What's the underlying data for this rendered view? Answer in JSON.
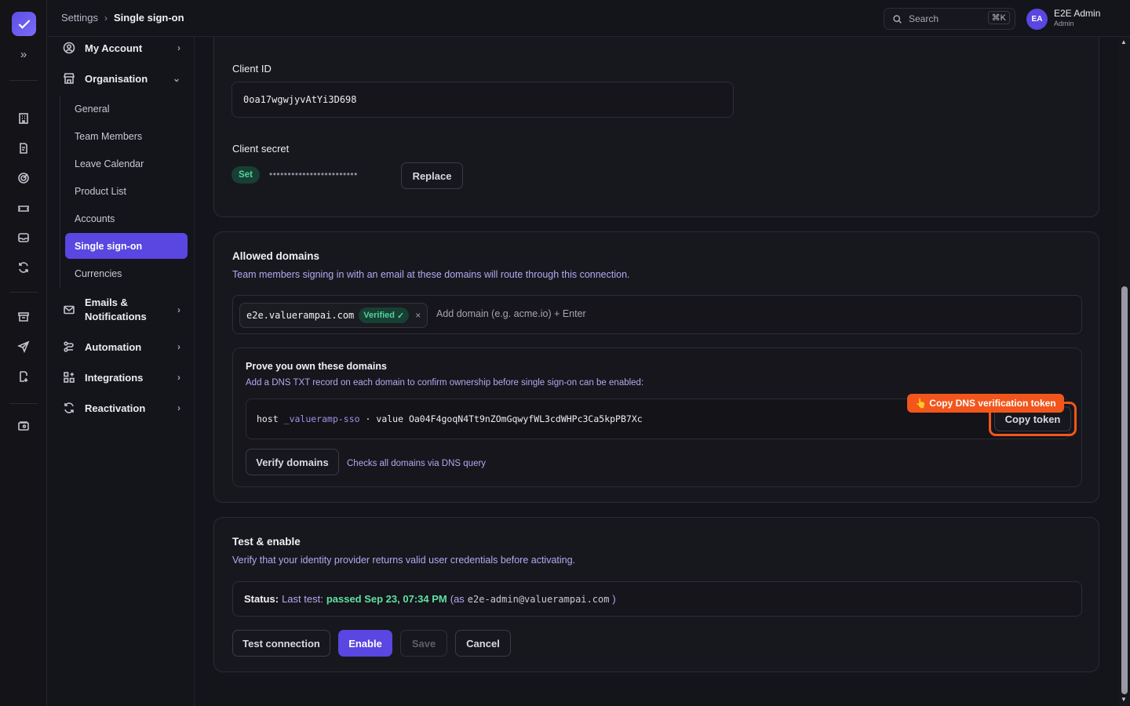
{
  "header": {
    "breadcrumb_root": "Settings",
    "breadcrumb_current": "Single sign-on",
    "search_placeholder": "Search",
    "search_shortcut": "⌘K",
    "user_initials": "EA",
    "user_name": "E2E Admin",
    "user_role": "Admin"
  },
  "sidebar": {
    "my_account": "My Account",
    "organisation": "Organisation",
    "sub_items": [
      "General",
      "Team Members",
      "Leave Calendar",
      "Product List",
      "Accounts",
      "Single sign-on",
      "Currencies"
    ],
    "active_item": "Single sign-on",
    "emails_line1": "Emails &",
    "emails_line2": "Notifications",
    "automation": "Automation",
    "integrations": "Integrations",
    "reactivation": "Reactivation"
  },
  "credentials": {
    "client_id_label": "Client ID",
    "client_id_value": "0oa17wgwjyvAtYi3D698",
    "client_secret_label": "Client secret",
    "secret_badge": "Set",
    "secret_mask": "••••••••••••••••••••••••",
    "replace_label": "Replace"
  },
  "domains": {
    "title": "Allowed domains",
    "description": "Team members signing in with an email at these domains will route through this connection.",
    "chip_domain": "e2e.valuerampai.com",
    "chip_status": "Verified",
    "chip_check": "✓",
    "chip_remove": "×",
    "add_placeholder": "Add domain (e.g. acme.io) + Enter",
    "prove_title": "Prove you own these domains",
    "prove_description": "Add a DNS TXT record on each domain to confirm ownership before single sign-on can be enabled:",
    "record_host_label": "host",
    "record_host": "_valueramp-sso",
    "record_sep": "·",
    "record_value_label": "value",
    "record_value": "Oa04F4goqN4Tt9nZOmGqwyfWL3cdWHPc3Ca5kpPB7Xc",
    "tooltip": "👆 Copy DNS verification token",
    "copy_label": "Copy token",
    "verify_label": "Verify domains",
    "verify_hint": "Checks all domains via DNS query"
  },
  "test": {
    "title": "Test & enable",
    "description": "Verify that your identity provider returns valid user credentials before activating.",
    "status_key": "Status:",
    "status_last": "Last test:",
    "status_result": "passed Sep 23, 07:34 PM",
    "status_as_open": "(as",
    "status_email": "e2e-admin@valuerampai.com",
    "status_as_close": ")",
    "test_connection": "Test connection",
    "enable": "Enable",
    "save": "Save",
    "cancel": "Cancel"
  },
  "colors": {
    "accent": "#5a46e0",
    "success": "#52d39b",
    "highlight": "#f2561c",
    "background": "#14141b"
  }
}
